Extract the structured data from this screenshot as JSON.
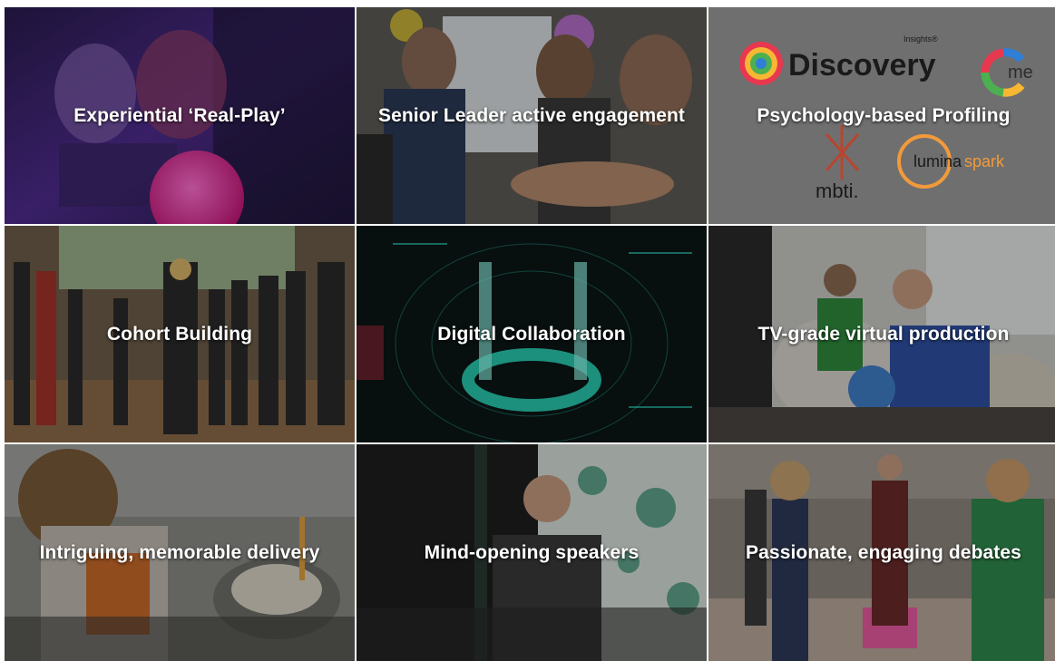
{
  "tiles": [
    {
      "caption": "Experiential ‘Real-Play’"
    },
    {
      "caption": "Senior Leader active engagement"
    },
    {
      "caption": "Psychology-based Profiling"
    },
    {
      "caption": "Cohort Building"
    },
    {
      "caption": "Digital Collaboration"
    },
    {
      "caption": "TV-grade virtual production"
    },
    {
      "caption": "Intriguing, memorable delivery"
    },
    {
      "caption": "Mind-opening speakers"
    },
    {
      "caption": "Passionate, engaging debates"
    }
  ],
  "logos": {
    "discovery": "Discovery",
    "insights": "Insights®",
    "me": "me",
    "mbti": "mbti.",
    "lumina": "lumina",
    "spark": "spark"
  },
  "colors": {
    "caption": "#ffffff",
    "tile1_tint": "#4b2d8a",
    "tile5_accent": "#2ee6c8",
    "logo_panel": "#6f6f6f",
    "lumina_accent": "#f29a3b"
  }
}
